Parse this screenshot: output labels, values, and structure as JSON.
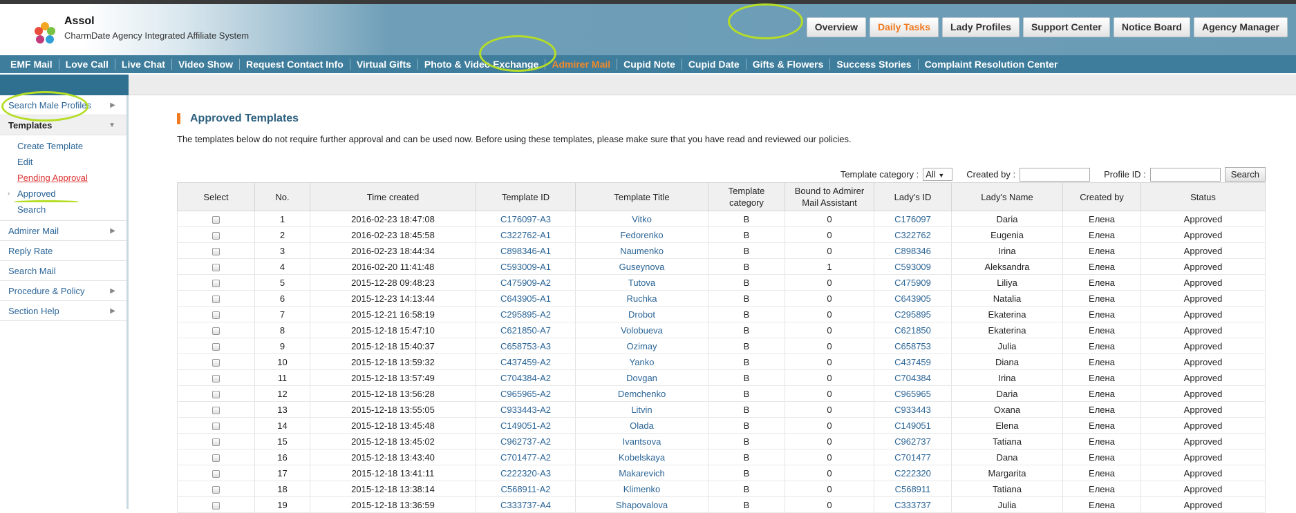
{
  "header": {
    "brand_name": "Assol",
    "brand_subtitle": "CharmDate Agency Integrated Affiliate System",
    "top_nav": [
      "Overview",
      "Daily Tasks",
      "Lady Profiles",
      "Support Center",
      "Notice Board",
      "Agency Manager"
    ],
    "top_nav_active": "Daily Tasks"
  },
  "main_nav": {
    "items": [
      "EMF Mail",
      "Love Call",
      "Live Chat",
      "Video Show",
      "Request Contact Info",
      "Virtual Gifts",
      "Photo & Video Exchange",
      "Admirer Mail",
      "Cupid Note",
      "Cupid Date",
      "Gifts & Flowers",
      "Success Stories",
      "Complaint Resolution Center"
    ],
    "active": "Admirer Mail"
  },
  "sidebar": {
    "search_male": "Search Male Profiles",
    "templates": "Templates",
    "template_sub": [
      "Create Template",
      "Edit",
      "Pending Approval",
      "Approved",
      "Search"
    ],
    "admirer_mail": "Admirer Mail",
    "reply_rate": "Reply Rate",
    "search_mail": "Search Mail",
    "procedure_policy": "Procedure & Policy",
    "section_help": "Section Help"
  },
  "content": {
    "title": "Approved Templates",
    "intro": "The templates below do not require further approval and can be used now. Before using these templates, please make sure that you have read and reviewed our policies."
  },
  "filters": {
    "category_label": "Template category :",
    "category_value": "All",
    "created_by_label": "Created by :",
    "created_by_value": "",
    "profile_id_label": "Profile ID :",
    "profile_id_value": "",
    "search_button": "Search"
  },
  "table": {
    "headers": [
      "Select",
      "No.",
      "Time created",
      "Template ID",
      "Template Title",
      "Template category",
      "Bound to Admirer Mail Assistant",
      "Lady's ID",
      "Lady's Name",
      "Created by",
      "Status"
    ],
    "rows": [
      [
        "1",
        "2016-02-23 18:47:08",
        "C176097-A3",
        "Vitko",
        "B",
        "0",
        "C176097",
        "Daria",
        "Елена",
        "Approved"
      ],
      [
        "2",
        "2016-02-23 18:45:58",
        "C322762-A1",
        "Fedorenko",
        "B",
        "0",
        "C322762",
        "Eugenia",
        "Елена",
        "Approved"
      ],
      [
        "3",
        "2016-02-23 18:44:34",
        "C898346-A1",
        "Naumenko",
        "B",
        "0",
        "C898346",
        "Irina",
        "Елена",
        "Approved"
      ],
      [
        "4",
        "2016-02-20 11:41:48",
        "C593009-A1",
        "Guseynova",
        "B",
        "1",
        "C593009",
        "Aleksandra",
        "Елена",
        "Approved"
      ],
      [
        "5",
        "2015-12-28 09:48:23",
        "C475909-A2",
        "Tutova",
        "B",
        "0",
        "C475909",
        "Liliya",
        "Елена",
        "Approved"
      ],
      [
        "6",
        "2015-12-23 14:13:44",
        "C643905-A1",
        "Ruchka",
        "B",
        "0",
        "C643905",
        "Natalia",
        "Елена",
        "Approved"
      ],
      [
        "7",
        "2015-12-21 16:58:19",
        "C295895-A2",
        "Drobot",
        "B",
        "0",
        "C295895",
        "Ekaterina",
        "Елена",
        "Approved"
      ],
      [
        "8",
        "2015-12-18 15:47:10",
        "C621850-A7",
        "Volobueva",
        "B",
        "0",
        "C621850",
        "Ekaterina",
        "Елена",
        "Approved"
      ],
      [
        "9",
        "2015-12-18 15:40:37",
        "C658753-A3",
        "Ozimay",
        "B",
        "0",
        "C658753",
        "Julia",
        "Елена",
        "Approved"
      ],
      [
        "10",
        "2015-12-18 13:59:32",
        "C437459-A2",
        "Yanko",
        "B",
        "0",
        "C437459",
        "Diana",
        "Елена",
        "Approved"
      ],
      [
        "11",
        "2015-12-18 13:57:49",
        "C704384-A2",
        "Dovgan",
        "B",
        "0",
        "C704384",
        "Irina",
        "Елена",
        "Approved"
      ],
      [
        "12",
        "2015-12-18 13:56:28",
        "C965965-A2",
        "Demchenko",
        "B",
        "0",
        "C965965",
        "Daria",
        "Елена",
        "Approved"
      ],
      [
        "13",
        "2015-12-18 13:55:05",
        "C933443-A2",
        "Litvin",
        "B",
        "0",
        "C933443",
        "Oxana",
        "Елена",
        "Approved"
      ],
      [
        "14",
        "2015-12-18 13:45:48",
        "C149051-A2",
        "Olada",
        "B",
        "0",
        "C149051",
        "Elena",
        "Елена",
        "Approved"
      ],
      [
        "15",
        "2015-12-18 13:45:02",
        "C962737-A2",
        "Ivantsova",
        "B",
        "0",
        "C962737",
        "Tatiana",
        "Елена",
        "Approved"
      ],
      [
        "16",
        "2015-12-18 13:43:40",
        "C701477-A2",
        "Kobelskaya",
        "B",
        "0",
        "C701477",
        "Dana",
        "Елена",
        "Approved"
      ],
      [
        "17",
        "2015-12-18 13:41:11",
        "C222320-A3",
        "Makarevich",
        "B",
        "0",
        "C222320",
        "Margarita",
        "Елена",
        "Approved"
      ],
      [
        "18",
        "2015-12-18 13:38:14",
        "C568911-A2",
        "Klimenko",
        "B",
        "0",
        "C568911",
        "Tatiana",
        "Елена",
        "Approved"
      ],
      [
        "19",
        "2015-12-18 13:36:59",
        "C333737-A4",
        "Shapovalova",
        "B",
        "0",
        "C333737",
        "Julia",
        "Елена",
        "Approved"
      ]
    ]
  },
  "colors": {
    "accent_orange": "#f07a21",
    "nav_blue": "#3e7d9c",
    "link_blue": "#2a6496",
    "annotation_green": "#b5dd26"
  }
}
